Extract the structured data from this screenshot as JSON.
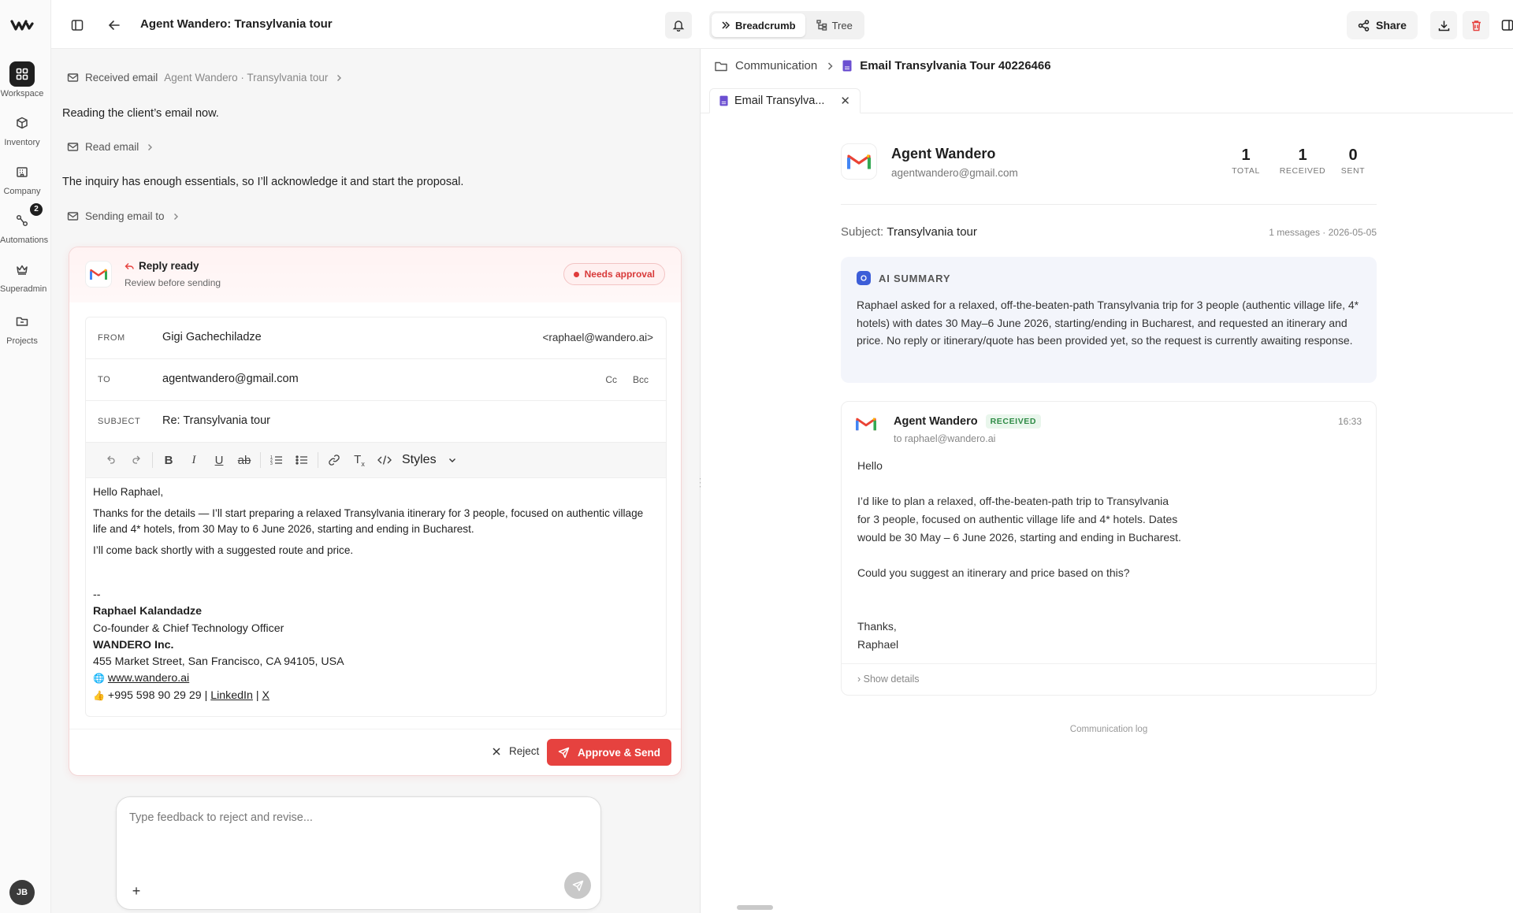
{
  "rail": {
    "items": [
      {
        "label": "Workspace",
        "icon": "grid-icon",
        "active": true
      },
      {
        "label": "Inventory",
        "icon": "box-icon",
        "active": false
      },
      {
        "label": "Company",
        "icon": "building-icon",
        "active": false
      },
      {
        "label": "Automations",
        "icon": "workflow-icon",
        "active": false,
        "badge": "2"
      },
      {
        "label": "Superadmin",
        "icon": "crown-icon",
        "active": false
      },
      {
        "label": "Projects",
        "icon": "folder-icon",
        "active": false
      }
    ],
    "avatar": "JB"
  },
  "topbar": {
    "title": "Agent Wandero: Transylvania tour",
    "view_breadcrumb": "Breadcrumb",
    "view_tree": "Tree",
    "share": "Share"
  },
  "chat": {
    "steps": {
      "received_label": "Received email",
      "received_sub": "Agent Wandero · Transylvania tour",
      "read_label": "Read email",
      "sending_label": "Sending email to"
    },
    "narration_1": "Reading the client’s email now.",
    "narration_2": "The inquiry has enough essentials, so I’ll acknowledge it and start the proposal.",
    "reply": {
      "title": "Reply ready",
      "subtitle": "Review before sending",
      "status": "Needs approval",
      "from_key": "FROM",
      "from_name": "Gigi Gachechiladze",
      "from_addr": "<raphael@wandero.ai>",
      "to_key": "TO",
      "to_value": "agentwandero@gmail.com",
      "cc": "Cc",
      "bcc": "Bcc",
      "subject_key": "SUBJECT",
      "subject_value": "Re: Transylvania tour",
      "styles": "Styles",
      "body": {
        "greeting": "Hello Raphael,",
        "p1": "Thanks for the details — I’ll start preparing a relaxed Transylvania itinerary for 3 people, focused on authentic village life and 4* hotels, from 30 May to 6 June 2026, starting and ending in Bucharest.",
        "p2": "I’ll come back shortly with a suggested route and price."
      },
      "signature": {
        "dashes": "--",
        "name": "Raphael Kalandadze",
        "role": "Co-founder & Chief Technology Officer",
        "company": "WANDERO Inc.",
        "address": "455 Market Street, San Francisco, CA 94105, USA",
        "website": "www.wandero.ai",
        "phone": "+995 598 90 29 29",
        "sep": "|",
        "linkedin": "LinkedIn",
        "x": "X"
      },
      "reject": "Reject",
      "approve": "Approve & Send"
    },
    "feedback_placeholder": "Type feedback to reject and revise..."
  },
  "right": {
    "breadcrumb_root": "Communication",
    "breadcrumb_current": "Email Transylvania Tour 40226466",
    "tab_label": "Email Transylva...",
    "contact_name": "Agent Wandero",
    "contact_email": "agentwandero@gmail.com",
    "stats": [
      {
        "value": "1",
        "label": "TOTAL"
      },
      {
        "value": "1",
        "label": "RECEIVED"
      },
      {
        "value": "0",
        "label": "SENT"
      }
    ],
    "subject_label": "Subject:",
    "subject_value": "Transylvania tour",
    "meta": "1 messages · 2026-05-05",
    "summary_title": "AI SUMMARY",
    "summary_text": "Raphael asked for a relaxed, off-the-beaten-path Transylvania trip for 3 people (authentic village life, 4* hotels) with dates 30 May–6 June 2026, starting/ending in Bucharest, and requested an itinerary and price. No reply or itinerary/quote has been provided yet, so the request is currently awaiting response.",
    "message": {
      "from": "Agent Wandero",
      "badge": "RECEIVED",
      "to": "to raphael@wandero.ai",
      "time": "16:33",
      "greeting": "Hello",
      "line1": "I’d like to plan a relaxed, off-the-beaten-path trip to Transylvania",
      "line2": "for 3 people, focused on authentic village life and 4* hotels. Dates",
      "line3": "would be 30 May – 6 June 2026, starting and ending in Bucharest.",
      "question": "Could you suggest an itinerary and price based on this?",
      "thanks": "Thanks,",
      "signoff": "Raphael",
      "show_details": "› Show details"
    },
    "footer": "Communication log"
  },
  "colors": {
    "accent_red": "#e6423f",
    "received_green": "#2e8b45",
    "summary_bg": "#f3f5fb"
  }
}
